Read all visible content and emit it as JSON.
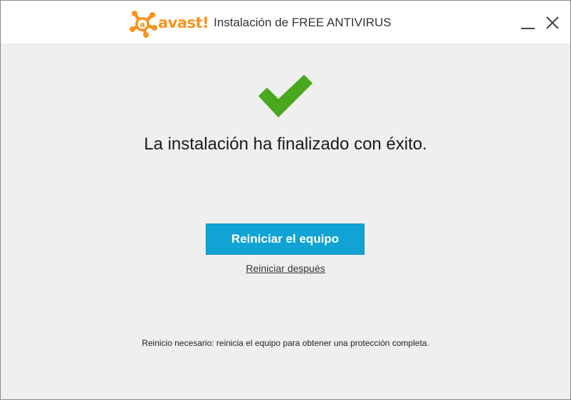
{
  "titlebar": {
    "logo_text": "avast!",
    "title": "Instalación de FREE ANTIVIRUS",
    "icons": {
      "logo": "avast-logo-icon",
      "minimize": "minimize-icon",
      "close": "close-icon"
    }
  },
  "main": {
    "status_icon": "checkmark-icon",
    "headline": "La instalación ha finalizado con éxito.",
    "restart_button_label": "Reiniciar el equipo",
    "restart_later_label": "Reiniciar después",
    "footnote": "Reinicio necesario: reinicia el equipo para obtener una protección completa."
  },
  "colors": {
    "brand_orange": "#f7931e",
    "check_green": "#4aa81e",
    "button_blue": "#11a3d3",
    "background": "#efefef"
  }
}
